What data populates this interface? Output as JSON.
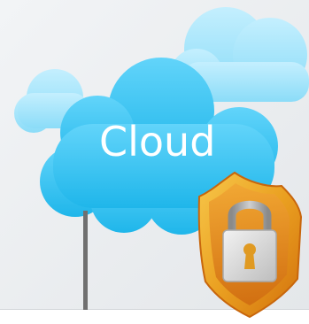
{
  "illustration": {
    "cloud_label": "Cloud",
    "icons": {
      "back_cloud": "cloud-icon",
      "main_cloud": "cloud-icon",
      "badge": "security-badge-icon",
      "lock": "padlock-icon"
    },
    "colors": {
      "background": "#eef0f2",
      "cloud_light": "#a9e6fb",
      "cloud_main": "#2cc4f4",
      "badge_gold": "#eaa021",
      "badge_orange": "#df7a12",
      "lock_body": "#d8d8d8",
      "pole": "#707070"
    }
  }
}
